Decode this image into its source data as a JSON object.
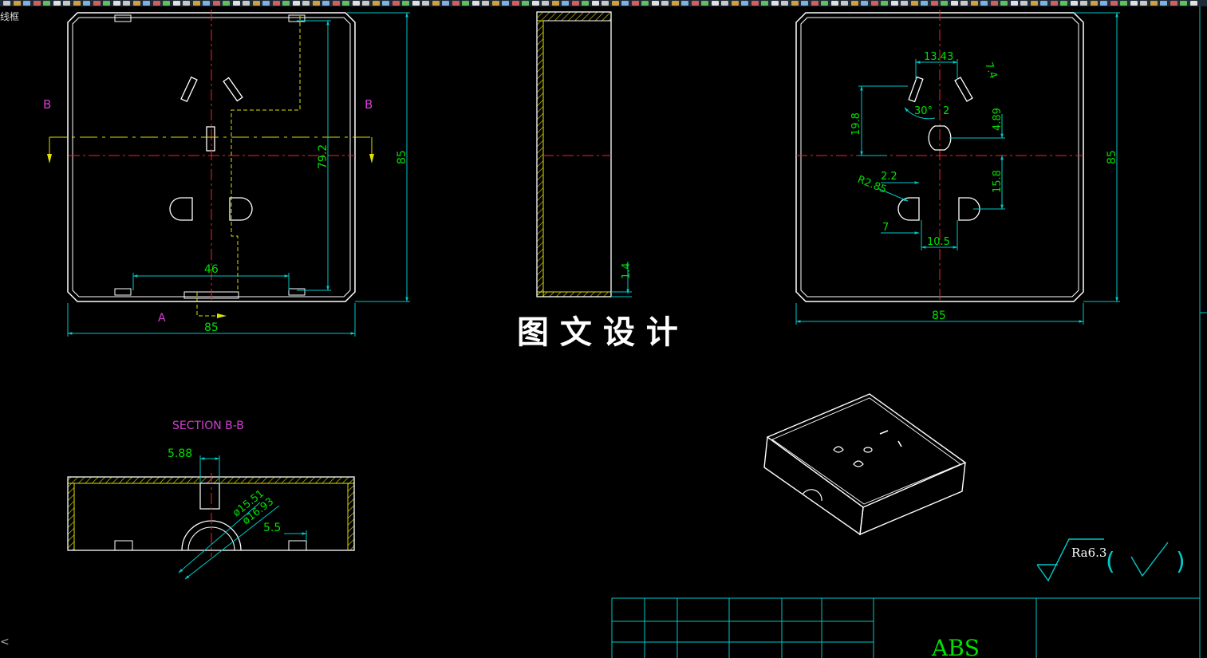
{
  "app": {
    "viewport_label": "线框",
    "corner_mark": "<"
  },
  "colors": {
    "background": "#000000",
    "outline": "#ffffff",
    "dimension": "#00e000",
    "extension": "#00c8c8",
    "centerline": "#ff2020",
    "hidden": "#e0e000",
    "section_label": "#d040d0",
    "hatch": "#e0e000",
    "watermark": "#ffffff",
    "title_block": "#00c8c8",
    "material_text": "#00e000"
  },
  "front_view": {
    "section_marks": [
      "B",
      "B"
    ],
    "view_mark": "A",
    "dims": {
      "width": "85",
      "height": "85",
      "inner_height": "79.2",
      "slot": "46"
    }
  },
  "side_view": {
    "dims": {
      "wall": "1.4"
    }
  },
  "right_view": {
    "dims": {
      "width": "85",
      "height": "85",
      "pin_spacing": "13.43",
      "pin_length": "7.4",
      "angle": "30°",
      "pin_width": "2",
      "upper_offset": "19.8",
      "center_offset": "4.89",
      "lower_offset": "15.8",
      "radius": "R2.85",
      "ground_width": "2.2",
      "ground_depth": "7",
      "lower_spacing": "10.5"
    }
  },
  "section_view": {
    "title": "SECTION B-B",
    "dims": {
      "rib_width": "5.88",
      "dia1": "ø15.51",
      "dia2": "ø16.93",
      "clip_width": "5.5"
    }
  },
  "watermark": "图 文 设 计",
  "surface_finish": {
    "value": "Ra6.3",
    "open": "(",
    "close": ")"
  },
  "title_block": {
    "material": "ABS"
  }
}
